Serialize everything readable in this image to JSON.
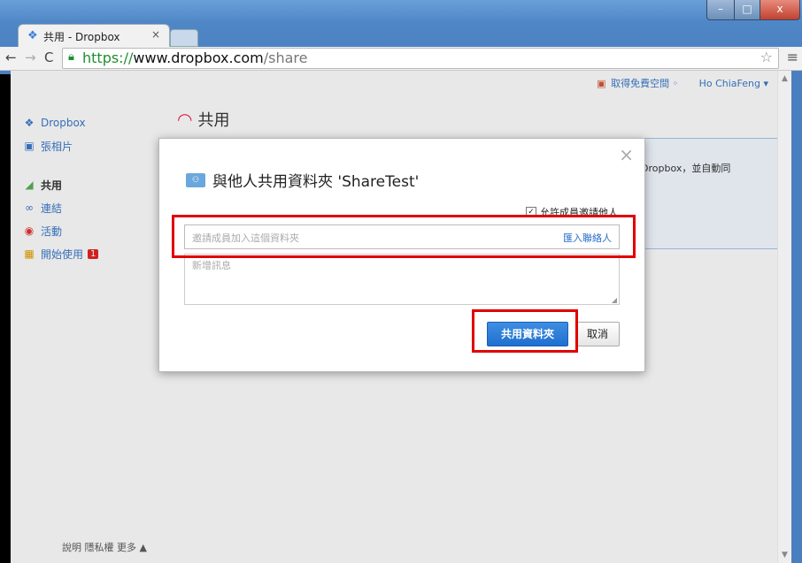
{
  "browser": {
    "tab_title": "共用 - Dropbox",
    "tab_close": "×",
    "url_scheme": "https://",
    "url_host": "www.dropbox.com",
    "url_path": "/share",
    "window_buttons": {
      "minimize": "–",
      "maximize": "□",
      "close": "x"
    }
  },
  "topbar": {
    "free_space": "取得免費空間 ◦",
    "user": "Ho ChiaFeng ▾"
  },
  "sidebar": {
    "items": [
      {
        "label": "Dropbox",
        "icon": "dropbox-icon"
      },
      {
        "label": "張相片",
        "icon": "photos-icon"
      },
      {
        "label": "共用",
        "icon": "share-icon"
      },
      {
        "label": "連結",
        "icon": "link-icon"
      },
      {
        "label": "活動",
        "icon": "activity-icon"
      },
      {
        "label": "開始使用",
        "icon": "get-started-icon",
        "badge": "1"
      }
    ]
  },
  "main": {
    "heading": "共用",
    "panel_text": "Dropbox，並自動同"
  },
  "footer": {
    "text": "說明 隱私權 更多 ▲"
  },
  "dialog": {
    "title": "與他人共用資料夾 'ShareTest'",
    "close": "×",
    "allow_members_invite": "允許成員邀請他人",
    "allow_checked": "✓",
    "invite_placeholder": "邀請成員加入這個資料夾",
    "import_contacts": "匯入聯絡人",
    "message_placeholder": "新增訊息",
    "share_button": "共用資料夾",
    "cancel_button": "取消"
  },
  "colors": {
    "accent": "#1e6fd0",
    "highlight": "#e00000",
    "link": "#3a76c4"
  }
}
